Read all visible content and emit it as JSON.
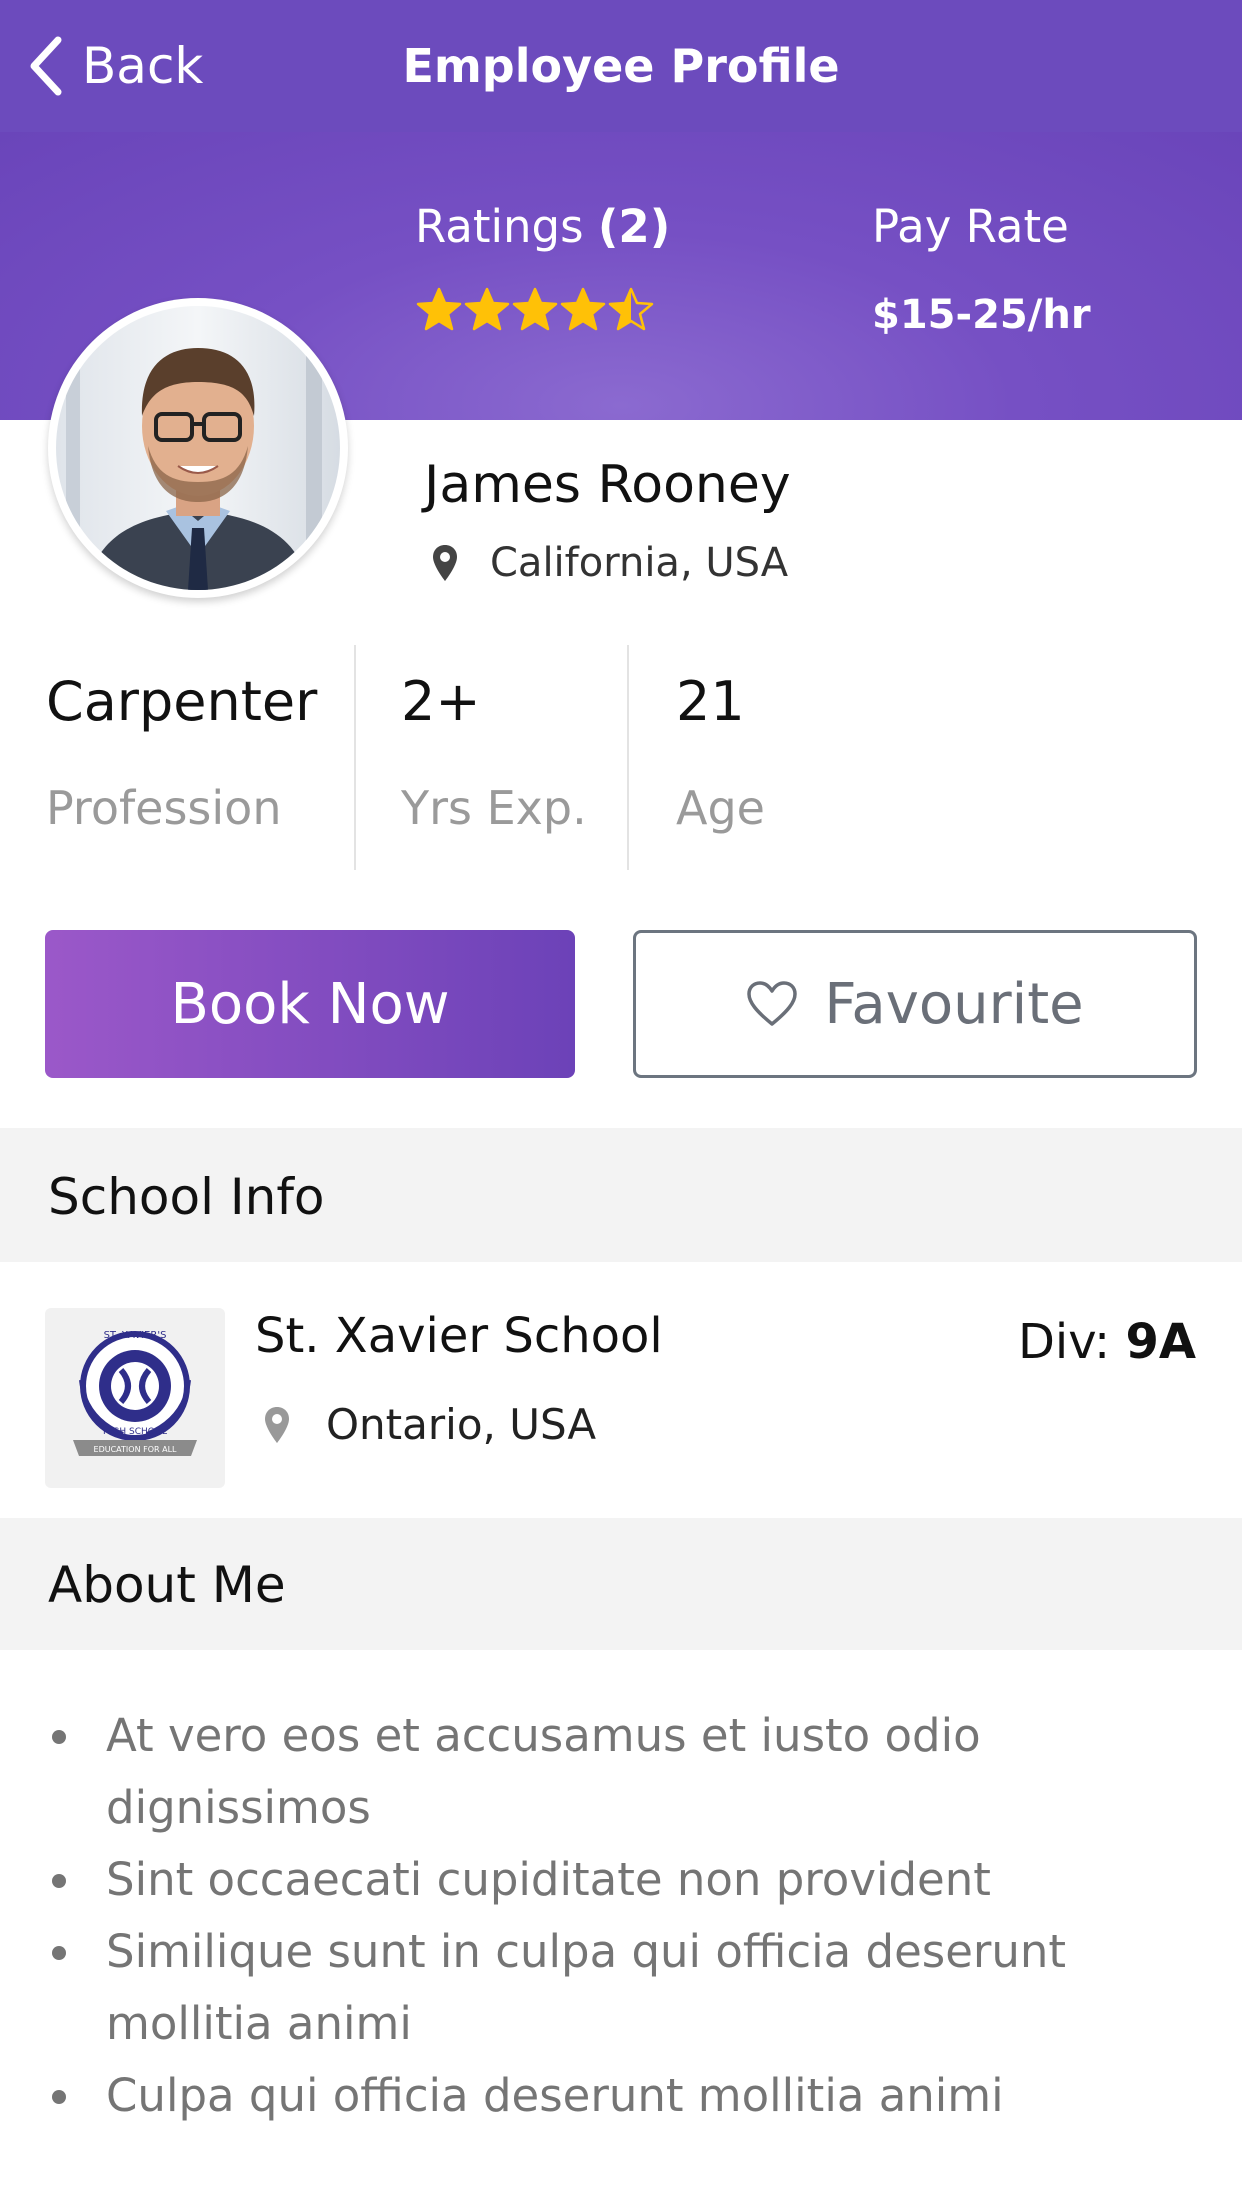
{
  "header": {
    "back_label": "Back",
    "title": "Employee Profile"
  },
  "profile": {
    "ratings_label": "Ratings",
    "ratings_count": "(2)",
    "rating_value": 4.5,
    "pay_label": "Pay Rate",
    "pay_value": "$15-25/hr",
    "name": "James Rooney",
    "location": "California, USA"
  },
  "stats": [
    {
      "value": "Carpenter",
      "label": "Profession"
    },
    {
      "value": "2+",
      "label": "Yrs Exp."
    },
    {
      "value": "21",
      "label": "Age"
    }
  ],
  "actions": {
    "book_label": "Book Now",
    "favourite_label": "Favourite"
  },
  "school": {
    "section_title": "School Info",
    "name": "St. Xavier School",
    "location": "Ontario, USA",
    "div_label": "Div:",
    "div_value": "9A",
    "logo_text_top": "ST. XAVIER'S",
    "logo_text_mid": "HIGH SCHOOL",
    "logo_ribbon": "EDUCATION FOR ALL"
  },
  "about": {
    "section_title": "About Me",
    "items": [
      "At vero eos et accusamus et iusto odio dignissimos",
      "Sint occaecati cupiditate non provident",
      "Similique sunt in culpa qui officia deserunt mollitia animi",
      "Culpa qui officia deserunt mollitia animi"
    ]
  },
  "colors": {
    "header_bg": "#6c4bbd",
    "star": "#ffc107",
    "accent_start": "#9b58c9",
    "accent_end": "#6c42b8"
  }
}
